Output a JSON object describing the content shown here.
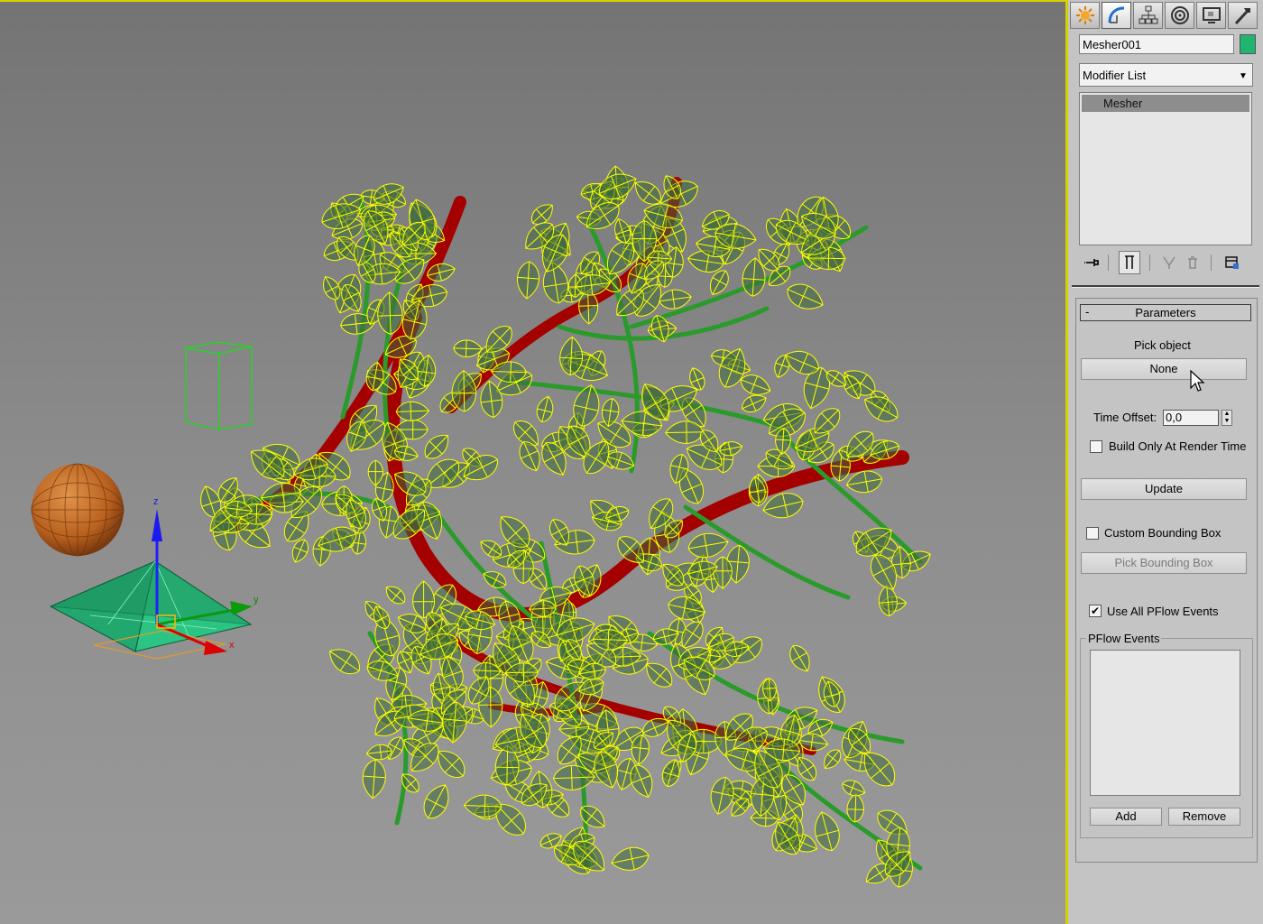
{
  "viewport": {
    "icons": [
      "sphere-object",
      "box-gizmo",
      "pyramid-emitter",
      "transform-gizmo",
      "tree-branch-mesh"
    ],
    "axis_labels": {
      "z": "z",
      "y": "y",
      "x": "x"
    },
    "colors": {
      "leaves": "#ffff00",
      "branches": "#2a9a2a",
      "trunk": "#a40000",
      "background": "#8a8a8a"
    }
  },
  "command_panel": {
    "tabs": [
      {
        "name": "create",
        "icon": "create-icon"
      },
      {
        "name": "modify",
        "icon": "modify-icon",
        "active": true
      },
      {
        "name": "hierarchy",
        "icon": "hierarchy-icon"
      },
      {
        "name": "motion",
        "icon": "motion-icon"
      },
      {
        "name": "display",
        "icon": "display-icon"
      },
      {
        "name": "utilities",
        "icon": "utilities-icon"
      }
    ],
    "object_name": "Mesher001",
    "object_color": "#1fb56f",
    "modifier_list": "Modifier List",
    "stack_items": [
      "Mesher"
    ],
    "parameters": {
      "header": "Parameters",
      "collapse": "-",
      "pick_object_label": "Pick object",
      "pick_object_button": "None",
      "time_offset_label": "Time Offset:",
      "time_offset_value": "0,0",
      "build_only_label": "Build Only At Render Time",
      "build_only_checked": false,
      "update_button": "Update",
      "custom_bbox_label": "Custom Bounding Box",
      "custom_bbox_checked": false,
      "pick_bbox_button": "Pick Bounding Box",
      "use_all_label": "Use All PFlow Events",
      "use_all_checked": true,
      "pflow_group_label": "PFlow Events",
      "add_button": "Add",
      "remove_button": "Remove"
    }
  }
}
